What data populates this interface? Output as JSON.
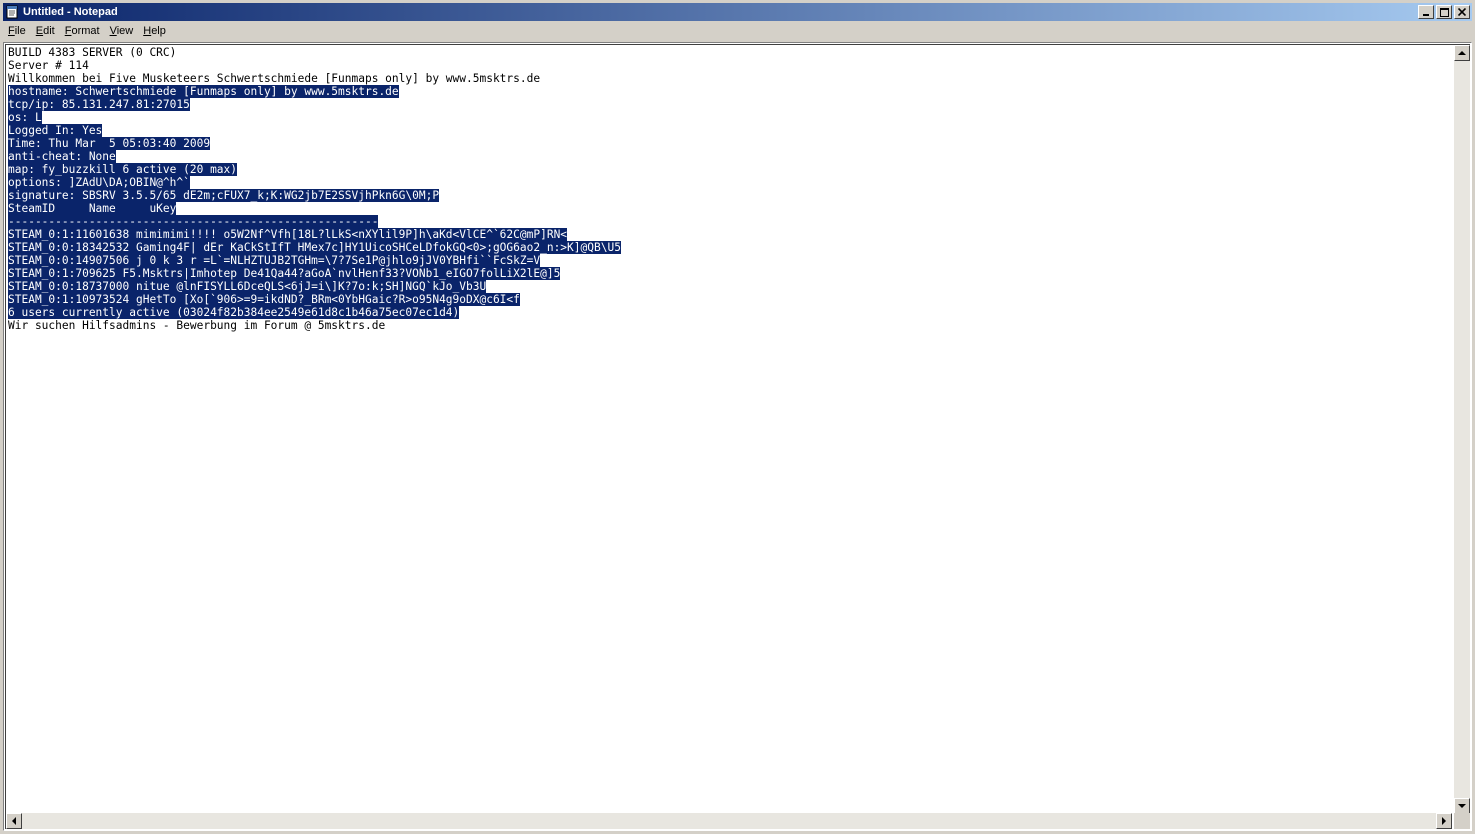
{
  "window": {
    "title": "Untitled - Notepad",
    "icon": "notepad-icon",
    "buttons": [
      "minimize-icon",
      "maximize-icon",
      "close-icon"
    ]
  },
  "menu": {
    "file": {
      "accel": "F",
      "rest": "ile"
    },
    "edit": {
      "accel": "E",
      "rest": "dit"
    },
    "format": {
      "accel": "F",
      "rest": "ormat"
    },
    "view": {
      "accel": "V",
      "rest": "iew"
    },
    "help": {
      "accel": "H",
      "rest": "elp"
    }
  },
  "colors": {
    "selection_bg": "#0a246a",
    "selection_fg": "#ffffff",
    "titlebar_start": "#0a246a",
    "titlebar_end": "#a6caf0"
  },
  "document": {
    "lines": [
      {
        "pre": "BUILD 4383 SERVER (0 CRC)",
        "sel": "",
        "post": ""
      },
      {
        "pre": "Server # 114",
        "sel": "",
        "post": ""
      },
      {
        "pre": "Willkommen bei Five Musketeers Schwertschmiede [Funmaps only] by www.5msktrs.de",
        "sel": "",
        "post": ""
      },
      {
        "pre": "",
        "sel": "hostname: Schwertschmiede [Funmaps only] by www.5msktrs.de",
        "post": ""
      },
      {
        "pre": "",
        "sel": "tcp/ip: 85.131.247.81:27015",
        "post": ""
      },
      {
        "pre": "",
        "sel": "os: L",
        "post": ""
      },
      {
        "pre": "",
        "sel": "Logged In: Yes",
        "post": ""
      },
      {
        "pre": "",
        "sel": "Time: Thu Mar  5 05:03:40 2009",
        "post": ""
      },
      {
        "pre": "",
        "sel": "anti-cheat: None",
        "post": ""
      },
      {
        "pre": "",
        "sel": "map: fy_buzzkill 6 active (20 max)",
        "post": ""
      },
      {
        "pre": "",
        "sel": "options: ]ZAdU\\DA;OBIN@^h^`",
        "post": ""
      },
      {
        "pre": "",
        "sel": "signature: SBSRV 3.5.5/65 dE2m;cFUX7_k;K:WG2jb7E2SSVjhPkn6G\\0M;P",
        "post": ""
      },
      {
        "pre": "",
        "sel": "SteamID     Name     uKey",
        "post": ""
      },
      {
        "pre": "",
        "sel": "-------------------------------------------------------",
        "post": ""
      },
      {
        "pre": "",
        "sel": "STEAM_0:1:11601638 mimimimi!!!! o5W2Nf^Vfh[18L?lLkS<nXYlil9P]h\\aKd<VlCE^`62C@mP]RN<",
        "post": ""
      },
      {
        "pre": "",
        "sel": "STEAM_0:0:18342532 Gaming4F| dEr KaCkStIfT HMex7c]HY1UicoSHCeLDfokGQ<0>;gOG6ao2_n:>K]@QB\\U5",
        "post": ""
      },
      {
        "pre": "",
        "sel": "STEAM_0:0:14907506 j 0 k 3 r =L`=NLHZTUJB2TGHm=\\7?7Se1P@jhlo9jJV0YBHfi``FcSkZ=V",
        "post": ""
      },
      {
        "pre": "",
        "sel": "STEAM_0:1:709625 F5.Msktrs|Imhotep De41Qa44?aGoA`nvlHenf33?VONb1_eIGO7folLiX2lE@]5",
        "post": ""
      },
      {
        "pre": "",
        "sel": "STEAM_0:0:18737000 nitue @lnFISYLL6DceQLS<6jJ=i\\]K?7o:k;SH]NGQ`kJo_Vb3U",
        "post": ""
      },
      {
        "pre": "",
        "sel": "STEAM_0:1:10973524 gHetTo [Xo[`906>=9=ikdND?_BRm<0YbHGaic?R>o95N4g9oDX@c6I<f",
        "post": ""
      },
      {
        "pre": "",
        "sel": "6 users currently active (03024f82b384ee2549e61d8c1b46a75ec07ec1d4)",
        "post": ""
      },
      {
        "pre": "Wir suchen Hilfsadmins - Bewerbung im Forum @ 5msktrs.de",
        "sel": "",
        "post": ""
      }
    ]
  }
}
